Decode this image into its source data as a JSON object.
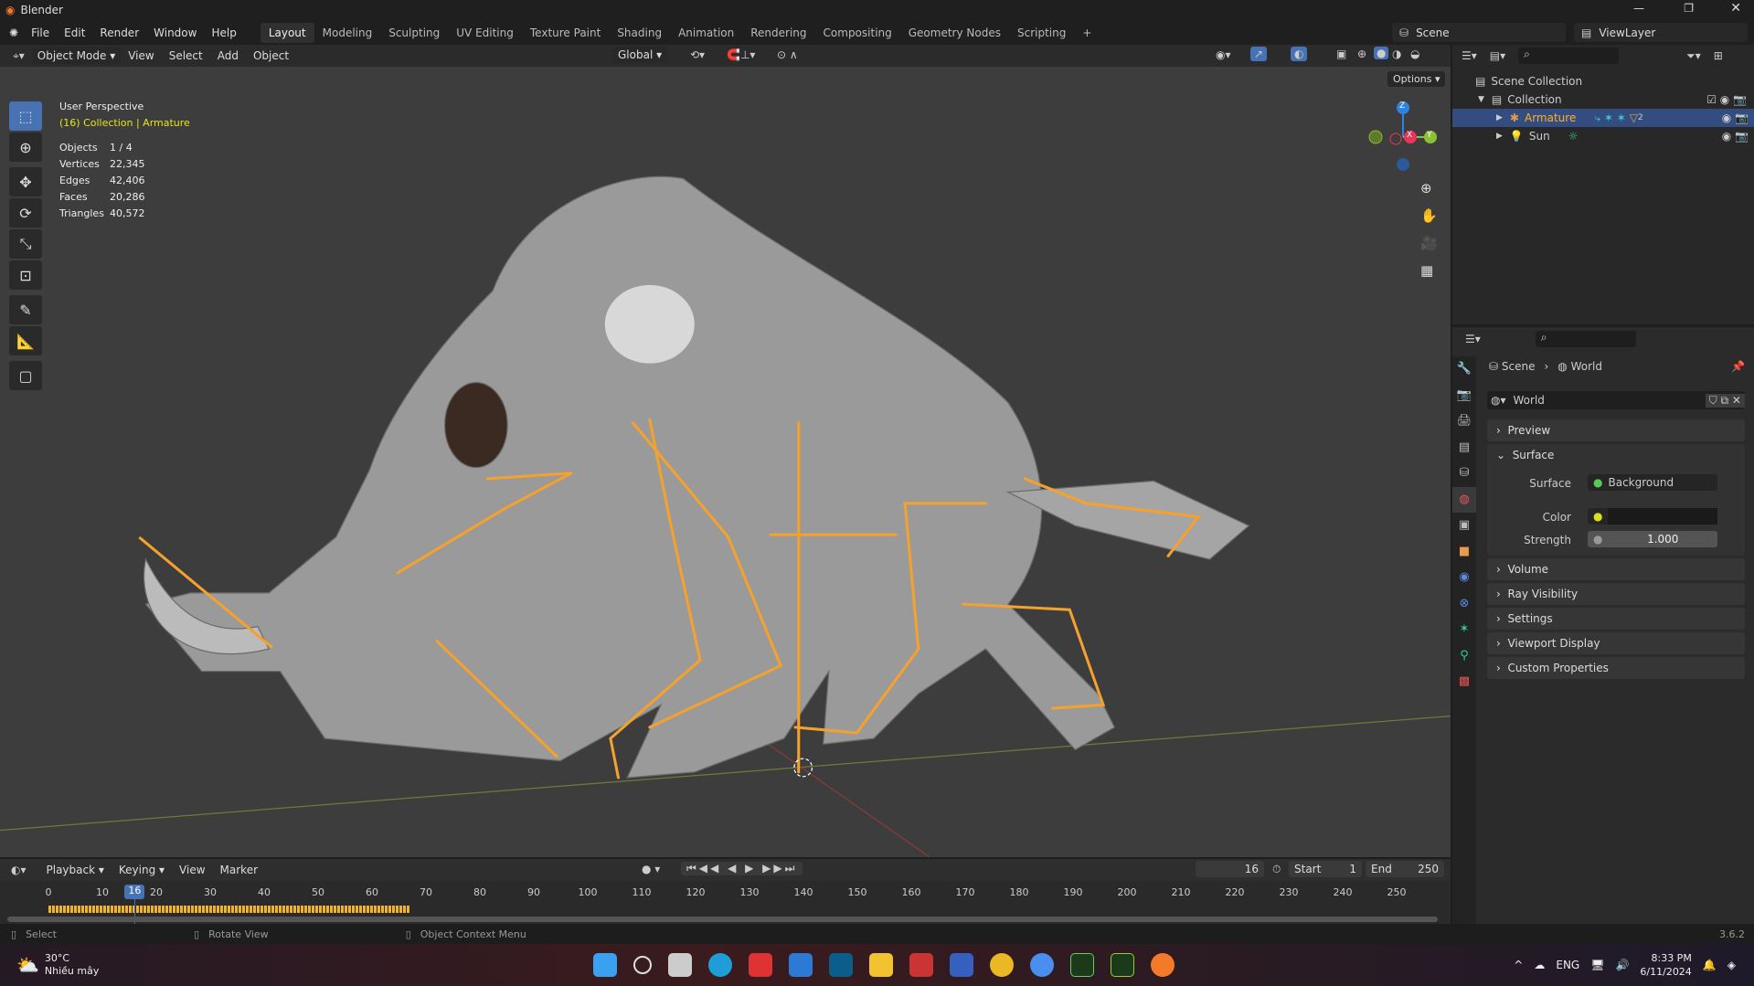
{
  "app": {
    "title": "Blender",
    "version": "3.6.2"
  },
  "menu": [
    "File",
    "Edit",
    "Render",
    "Window",
    "Help"
  ],
  "workspaces": [
    "Layout",
    "Modeling",
    "Sculpting",
    "UV Editing",
    "Texture Paint",
    "Shading",
    "Animation",
    "Rendering",
    "Compositing",
    "Geometry Nodes",
    "Scripting",
    "+"
  ],
  "scene": "Scene",
  "view_layer": "ViewLayer",
  "viewport_header": {
    "mode": "Object Mode",
    "menus": [
      "View",
      "Select",
      "Add",
      "Object"
    ],
    "orientation": "Global",
    "options": "Options"
  },
  "overlay": {
    "view": "User Perspective",
    "context": "(16) Collection | Armature",
    "stats": [
      {
        "label": "Objects",
        "value": "1 / 4"
      },
      {
        "label": "Vertices",
        "value": "22,345"
      },
      {
        "label": "Edges",
        "value": "42,406"
      },
      {
        "label": "Faces",
        "value": "20,286"
      },
      {
        "label": "Triangles",
        "value": "40,572"
      }
    ]
  },
  "gizmo": {
    "z": "Z",
    "x": "X",
    "y": "Y"
  },
  "outliner": {
    "items": [
      {
        "label": "Scene Collection"
      },
      {
        "label": "Collection"
      },
      {
        "label": "Armature",
        "selected": true
      },
      {
        "label": "Sun"
      }
    ],
    "mesh_count": "2"
  },
  "properties": {
    "breadcrumb": [
      "Scene",
      "World"
    ],
    "world_name": "World",
    "panels": {
      "preview": "Preview",
      "surface": "Surface",
      "volume": "Volume",
      "ray": "Ray Visibility",
      "settings": "Settings",
      "viewport_display": "Viewport Display",
      "custom": "Custom Properties"
    },
    "surface_label": "Surface",
    "surface_value": "Background",
    "color_label": "Color",
    "strength_label": "Strength",
    "strength_value": "1.000",
    "color_swatch": "#1a1a1a"
  },
  "timeline": {
    "menus": [
      "Playback",
      "Keying",
      "View",
      "Marker"
    ],
    "current_frame": "16",
    "start_label": "Start",
    "start": "1",
    "end_label": "End",
    "end": "250",
    "ticks": [
      "0",
      "10",
      "20",
      "30",
      "40",
      "50",
      "60",
      "70",
      "80",
      "90",
      "100",
      "110",
      "120",
      "130",
      "140",
      "150",
      "160",
      "170",
      "180",
      "190",
      "200",
      "210",
      "220",
      "230",
      "240",
      "250"
    ],
    "keyframes_end": 67
  },
  "status": {
    "select": "Select",
    "rotate": "Rotate View",
    "context_menu": "Object Context Menu"
  },
  "taskbar": {
    "weather_temp": "30°C",
    "weather_desc": "Nhiều mây",
    "lang": "ENG",
    "time": "8:33 PM",
    "date": "6/11/2024"
  },
  "colors": {
    "accent": "#4772b3",
    "bone": "#f5a12e",
    "selected_text": "#ffaf29",
    "context_yellow": "#e5e518"
  }
}
